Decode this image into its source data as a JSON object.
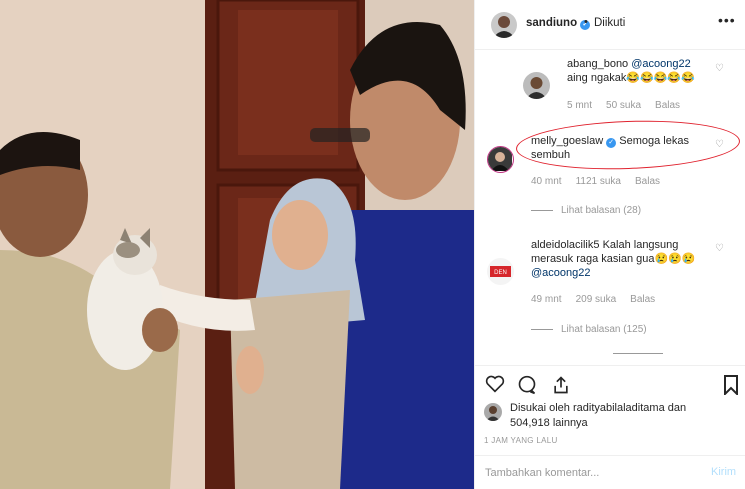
{
  "header": {
    "username": "sandiuno",
    "separator": "•",
    "follow_status": "Diikuti",
    "more_icon": "more-horizontal-icon"
  },
  "comments": [
    {
      "username": "abang_bono",
      "mention": "@acoong22",
      "text": "aing ngakak😂😂😂😂😂",
      "time": "5 mnt",
      "likes": "50 suka",
      "reply": "Balas"
    },
    {
      "username": "melly_goeslaw",
      "verified": true,
      "text": "Semoga lekas sembuh",
      "time": "40 mnt",
      "likes": "1121 suka",
      "reply": "Balas",
      "view_replies": "Lihat balasan (28)"
    },
    {
      "username": "aldeidolacilik5",
      "text": "Kalah langsung merasuk raga kasian gua😢😢😢",
      "mention": "@acoong22",
      "time": "49 mnt",
      "likes": "209 suka",
      "reply": "Balas",
      "view_replies": "Lihat balasan (125)"
    }
  ],
  "likes": {
    "text": "Disukai oleh radityabilaladitama dan 504,918 lainnya"
  },
  "time_ago": "1 JAM YANG LALU",
  "add_comment": {
    "placeholder": "Tambahkan komentar...",
    "post_label": "Kirim"
  },
  "colors": {
    "link": "#003569",
    "verified": "#3897f0",
    "muted": "#999999",
    "annotation": "#e0232f",
    "post_disabled": "#b2dffc"
  }
}
